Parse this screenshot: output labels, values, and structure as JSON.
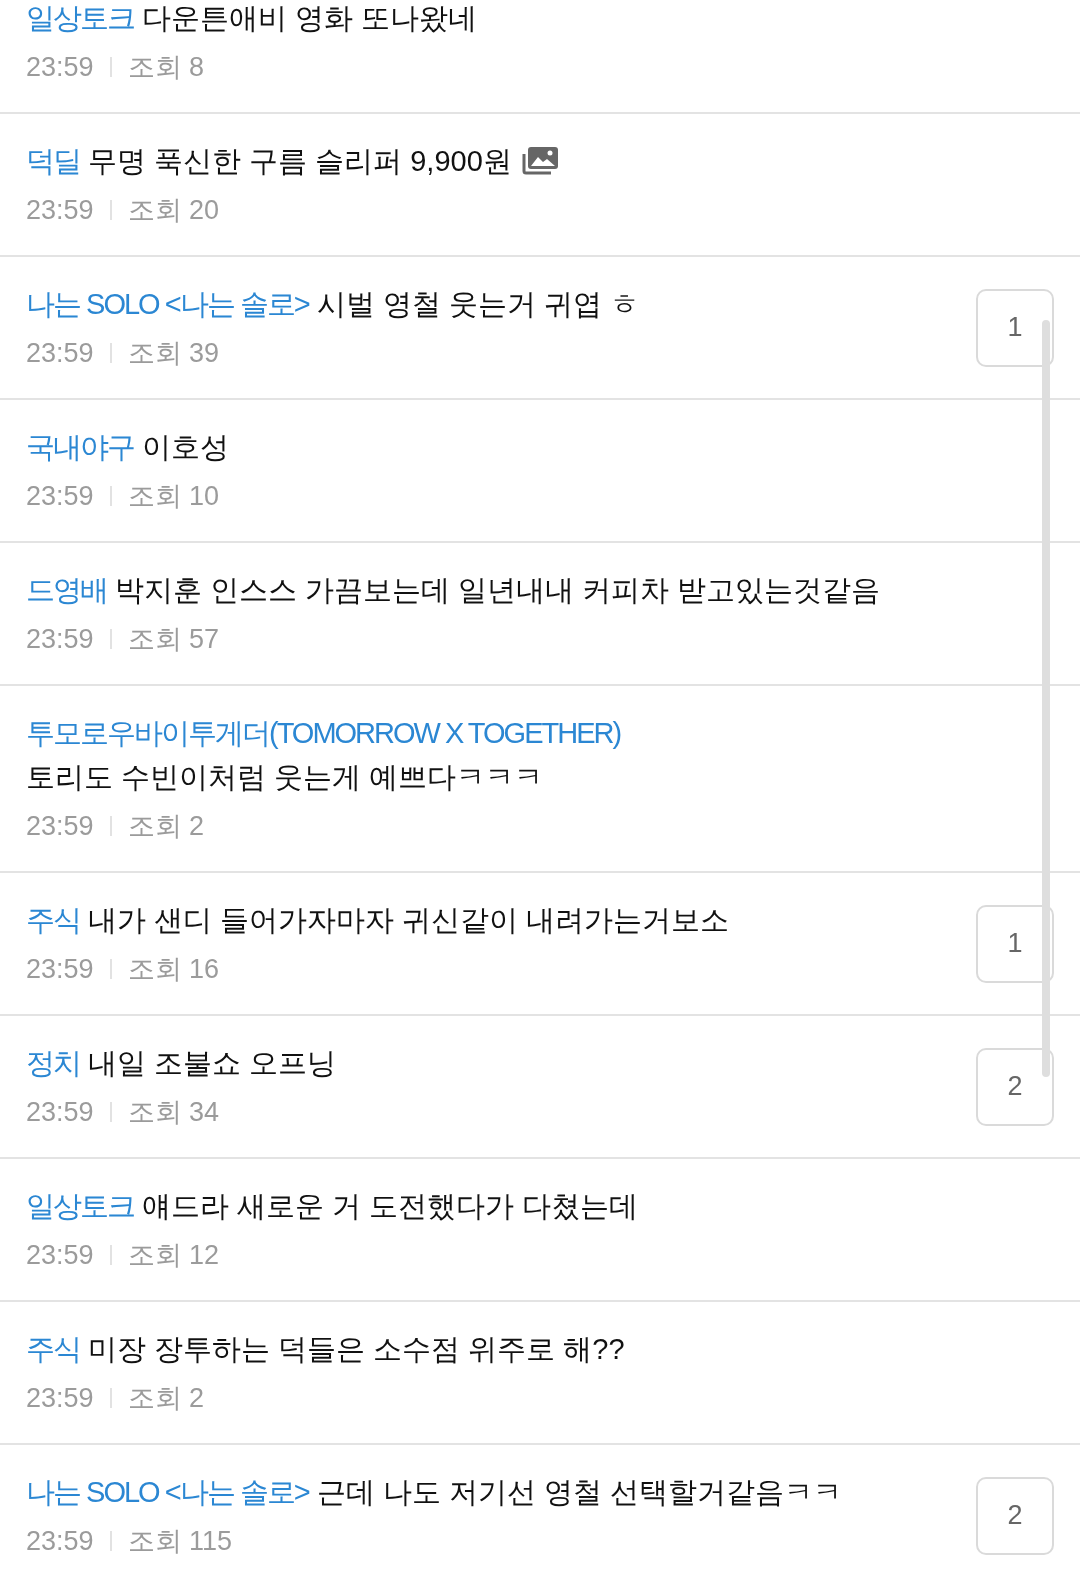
{
  "posts": [
    {
      "category": "일상토크",
      "title": "다운튼애비 영화 또나왔네",
      "has_image": false,
      "time": "23:59",
      "views": "조회 8"
    },
    {
      "category": "덕딜",
      "title": "무명 푹신한 구름 슬리퍼 9,900원",
      "has_image": true,
      "time": "23:59",
      "views": "조회 20"
    },
    {
      "category": "나는 SOLO <나는 솔로>",
      "title": "시벌 영철 웃는거 귀엽 ㅎ",
      "has_image": false,
      "time": "23:59",
      "views": "조회 39",
      "comments": "1"
    },
    {
      "category": "국내야구",
      "title": "이호성",
      "has_image": false,
      "time": "23:59",
      "views": "조회 10"
    },
    {
      "category": "드영배",
      "title": "박지훈 인스스 가끔보는데 일년내내 커피차 받고있는것같음",
      "has_image": false,
      "time": "23:59",
      "views": "조회 57"
    },
    {
      "category": "투모로우바이투게더(TOMORROW X TOGETHER)",
      "title": "토리도 수빈이처럼 웃는게 예쁘다ㅋㅋㅋ",
      "has_image": false,
      "time": "23:59",
      "views": "조회 2"
    },
    {
      "category": "주식",
      "title": "내가 샌디 들어가자마자 귀신같이 내려가는거보소",
      "has_image": false,
      "time": "23:59",
      "views": "조회 16",
      "comments": "1"
    },
    {
      "category": "정치",
      "title": "내일 조불쇼 오프닝",
      "has_image": false,
      "time": "23:59",
      "views": "조회 34",
      "comments": "2"
    },
    {
      "category": "일상토크",
      "title": "얘드라 새로운 거 도전했다가 다쳤는데",
      "has_image": false,
      "time": "23:59",
      "views": "조회 12"
    },
    {
      "category": "주식",
      "title": "미장 장투하는 덕들은 소수점 위주로 해??",
      "has_image": false,
      "time": "23:59",
      "views": "조회 2"
    },
    {
      "category": "나는 SOLO <나는 솔로>",
      "title": "근데 나도 저기선 영철 선택할거같음ㅋㅋ",
      "has_image": false,
      "time": "23:59",
      "views": "조회 115",
      "comments": "2"
    }
  ]
}
